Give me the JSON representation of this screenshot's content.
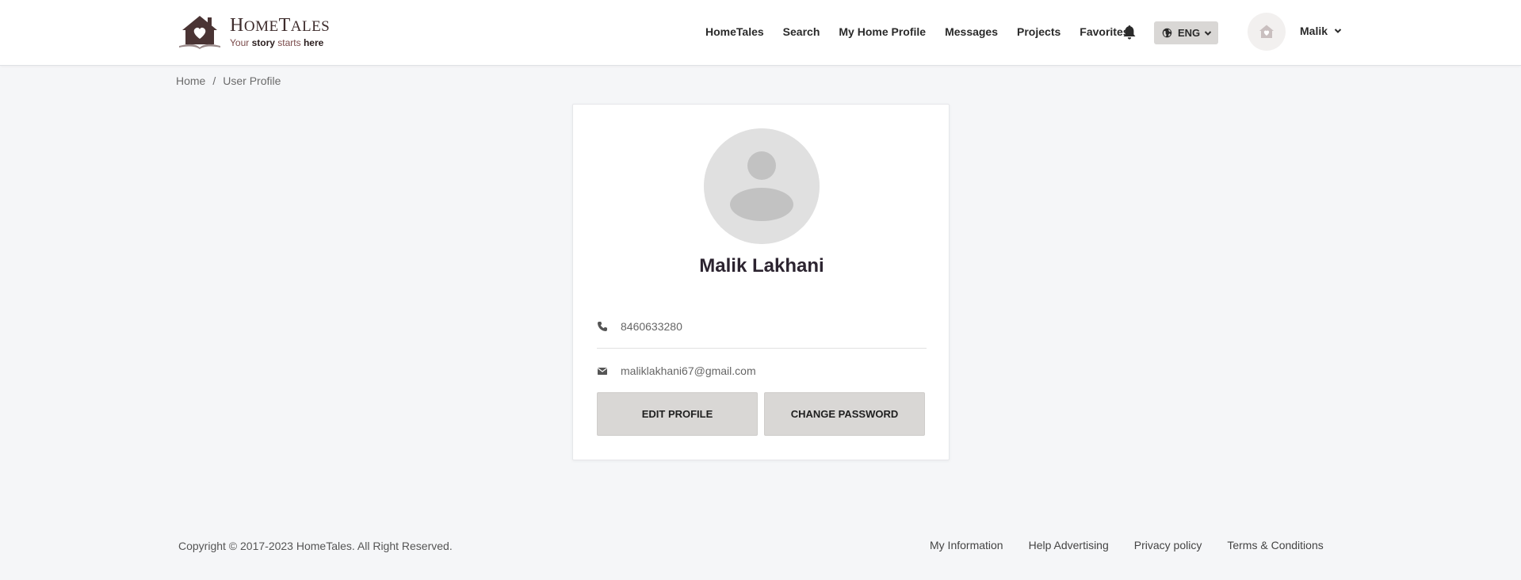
{
  "header": {
    "logo": {
      "title_big_h": "H",
      "title_rest_1": "OME",
      "title_big_t": "T",
      "title_rest_2": "ALES",
      "tag_1": "Your ",
      "tag_2": "story",
      "tag_3": " starts ",
      "tag_4": "here"
    },
    "nav": [
      "HomeTales",
      "Search",
      "My Home Profile",
      "Messages",
      "Projects",
      "Favorites"
    ],
    "language": "ENG",
    "user_name": "Malik"
  },
  "breadcrumb": {
    "home": "Home",
    "separator": "/",
    "current": "User Profile"
  },
  "profile": {
    "full_name": "Malik Lakhani",
    "phone": "8460633280",
    "email": "maliklakhani67@gmail.com",
    "edit_label": "EDIT PROFILE",
    "change_password_label": "CHANGE PASSWORD"
  },
  "footer": {
    "copyright": "Copyright © 2017-2023 HomeTales. All Right Reserved.",
    "links": [
      "My Information",
      "Help Advertising",
      "Privacy policy",
      "Terms & Conditions"
    ]
  },
  "colors": {
    "accent": "#d9d7d5",
    "brand": "#3d2b2b",
    "background": "#f5f6f8"
  },
  "icons": {
    "bell": "bell-icon",
    "globe": "globe-icon",
    "phone": "phone-icon",
    "email": "envelope-icon",
    "avatar": "user-avatar-icon"
  }
}
